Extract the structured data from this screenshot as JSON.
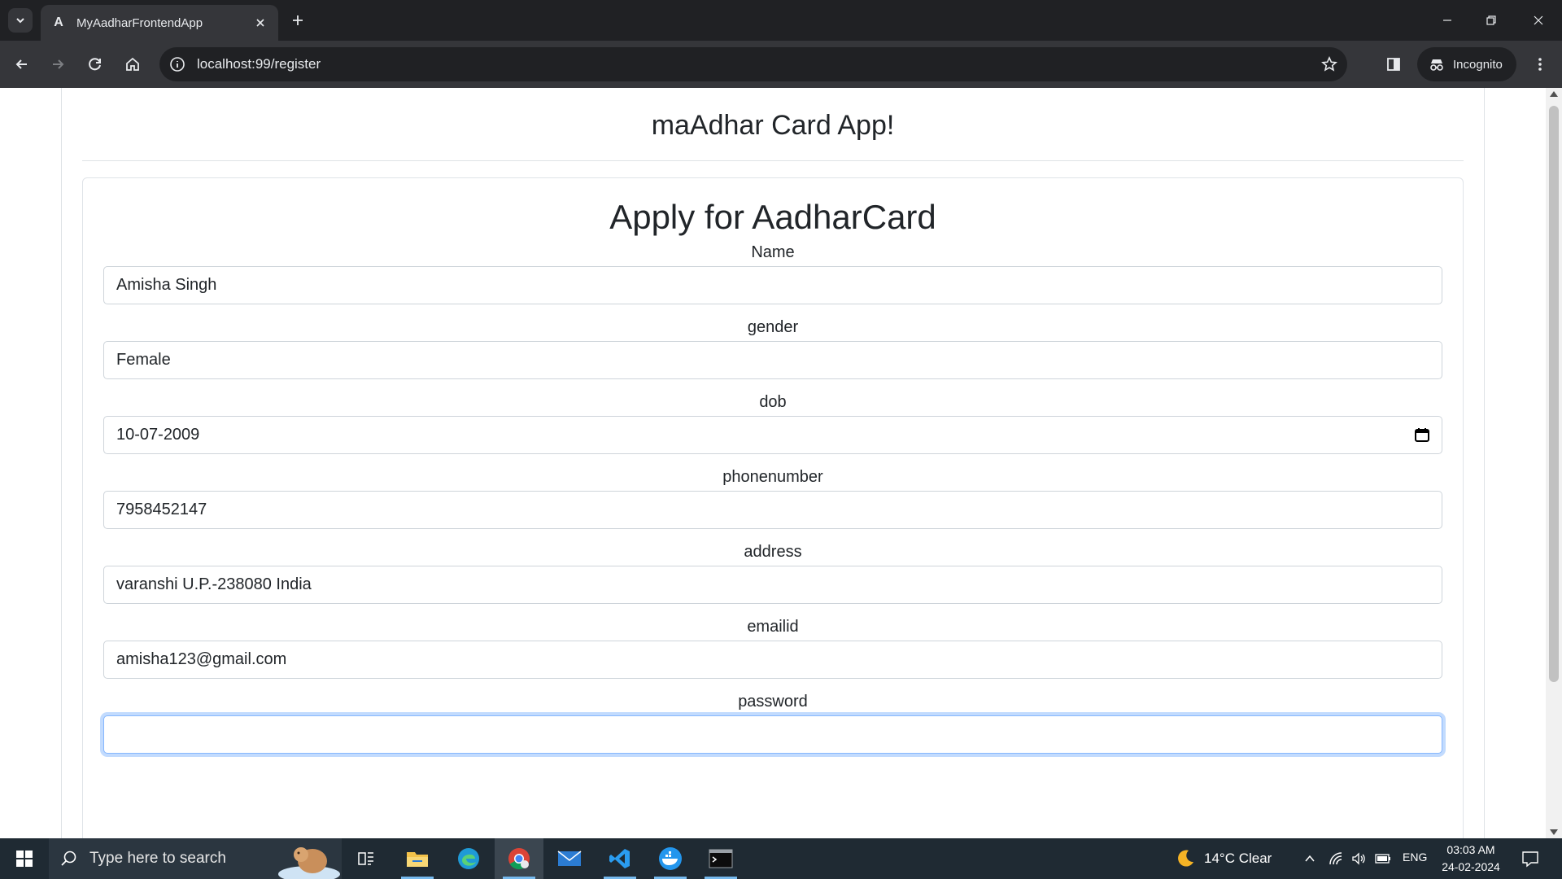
{
  "browser": {
    "tab_title": "MyAadharFrontendApp",
    "tab_favicon_letter": "A",
    "url": "localhost:99/register",
    "incognito_label": "Incognito"
  },
  "page": {
    "app_title": "maAdhar Card App!",
    "form_title": "Apply for AadharCard",
    "fields": [
      {
        "label": "Name",
        "value": "Amisha Singh"
      },
      {
        "label": "gender",
        "value": "Female"
      },
      {
        "label": "dob",
        "value": "10-07-2009"
      },
      {
        "label": "phonenumber",
        "value": "7958452147"
      },
      {
        "label": "address",
        "value": "varanshi U.P.-238080 India"
      },
      {
        "label": "emailid",
        "value": "amisha123@gmail.com"
      },
      {
        "label": "password",
        "value": ""
      }
    ]
  },
  "taskbar": {
    "search_placeholder": "Type here to search",
    "weather": "14°C  Clear",
    "language": "ENG",
    "time": "03:03 AM",
    "date": "24-02-2024"
  },
  "icons": {
    "tab_search": "chevron-down-icon",
    "close_tab": "close-icon",
    "new_tab": "plus-icon",
    "back": "arrow-left-icon",
    "forward": "arrow-right-icon",
    "reload": "reload-icon",
    "home": "home-icon",
    "site_info": "info-icon",
    "bookmark": "star-icon",
    "calendar": "calendar-icon"
  }
}
